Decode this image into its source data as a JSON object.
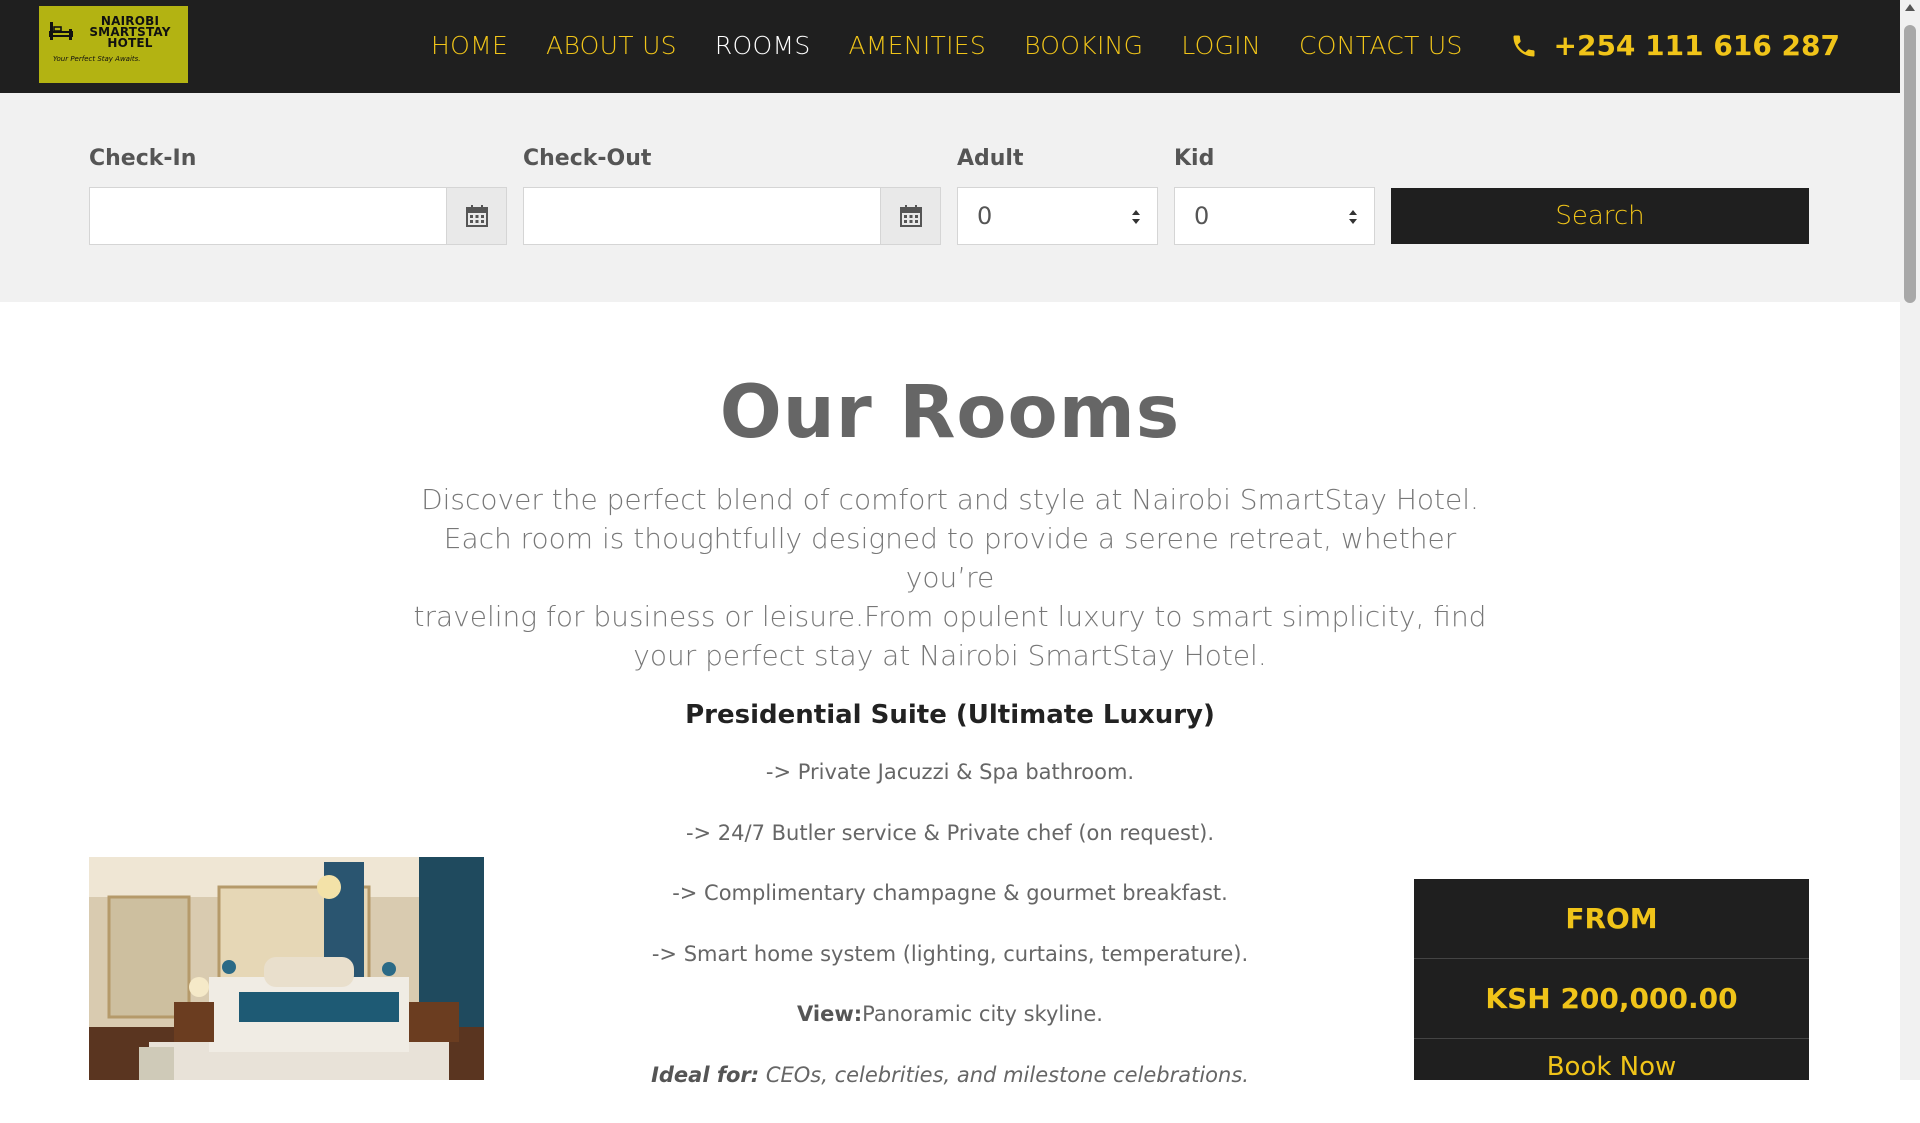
{
  "header": {
    "logo": {
      "name_line1": "NAIROBI",
      "name_line2": "SMARTSTAY",
      "name_line3": "HOTEL",
      "tagline": "Your Perfect Stay Awaits."
    },
    "nav": [
      "HOME",
      "ABOUT US",
      "ROOMS",
      "AMENITIES",
      "BOOKING",
      "LOGIN",
      "CONTACT US"
    ],
    "active_nav": "ROOMS",
    "phone": "+254 111 616 287"
  },
  "booking": {
    "checkin_label": "Check-In",
    "checkout_label": "Check-Out",
    "adult_label": "Adult",
    "kid_label": "Kid",
    "checkin_value": "",
    "checkout_value": "",
    "adult_value": "0",
    "kid_value": "0",
    "search_label": "Search"
  },
  "main": {
    "title": "Our Rooms",
    "intro_line1": "Discover the perfect blend of comfort and style at Nairobi SmartStay Hotel.",
    "intro_line2": "Each room is thoughtfully designed to provide a serene retreat, whether you’re",
    "intro_line3": "traveling for business or leisure.From opulent luxury to smart simplicity, find",
    "intro_line4": "your perfect stay at Nairobi SmartStay Hotel."
  },
  "room": {
    "name": "Presidential Suite (Ultimate Luxury)",
    "features": [
      "-> Private Jacuzzi & Spa bathroom.",
      "-> 24/7 Butler service & Private chef (on request).",
      "-> Complimentary champagne & gourmet breakfast.",
      "-> Smart home system (lighting, curtains, temperature)."
    ],
    "view_label": "View:",
    "view_value": "Panoramic city skyline.",
    "ideal_label": "Ideal for:",
    "ideal_value": " CEOs, celebrities, and milestone celebrations.",
    "price_from": "FROM",
    "price": "KSH 200,000.00",
    "book_label": "Book Now"
  },
  "colors": {
    "accent": "#f0c419",
    "dark": "#1f1f1f",
    "logo_bg": "#b3b312",
    "panel": "#f1f1f1"
  }
}
